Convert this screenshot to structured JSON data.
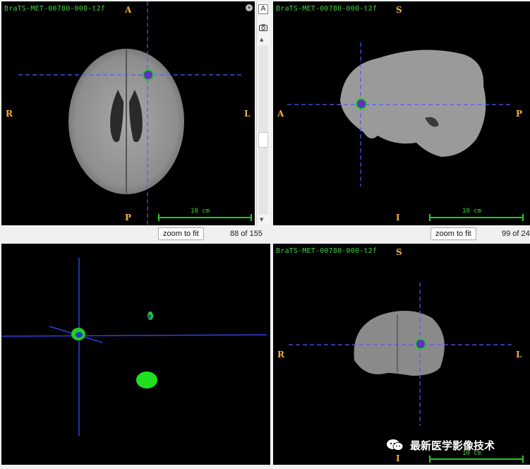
{
  "views": {
    "axial": {
      "title": "BraTS-MET-00780-000-t2f",
      "orient": {
        "top": "A",
        "bottom": "P",
        "left": "R",
        "right": "L"
      },
      "scale_label": "10 cm",
      "zoom_label": "zoom to fit",
      "slice": "88 of 155"
    },
    "sagittal": {
      "title": "BraTS-MET-00780-000-t2f",
      "orient": {
        "top": "S",
        "bottom": "I",
        "left": "A",
        "right": "P"
      },
      "scale_label": "10 cm",
      "zoom_label": "zoom to fit",
      "slice": "99 of 24"
    },
    "render3d": {},
    "coronal": {
      "title": "BraTS-MET-00780-000-t2f",
      "orient": {
        "top": "S",
        "bottom": "I",
        "left": "R",
        "right": "L"
      },
      "scale_label": "10 cm"
    }
  },
  "side_icons": {
    "label_icon_text": "A"
  },
  "watermark": "最新医学影像技术",
  "colors": {
    "crosshair": "#4a5cff",
    "label_green": "#3fd03f",
    "orientation": "#f0b040",
    "segmentation": "#22cc22",
    "tumor_core": "#6030c0"
  }
}
